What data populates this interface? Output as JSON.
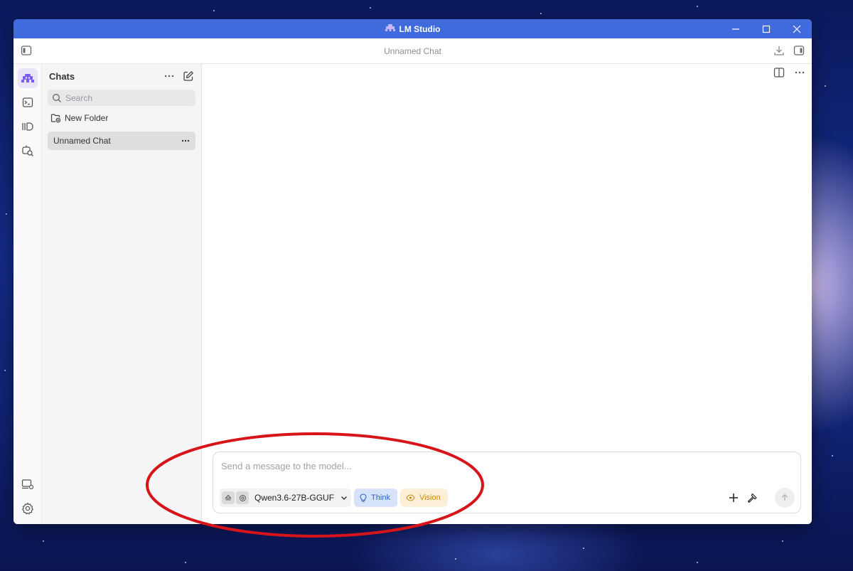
{
  "window": {
    "app_title": "LM Studio",
    "chat_title": "Unnamed Chat"
  },
  "sidebar": {
    "heading": "Chats",
    "search_placeholder": "Search",
    "new_folder_label": "New Folder",
    "chats": [
      {
        "label": "Unnamed Chat"
      }
    ]
  },
  "composer": {
    "placeholder": "Send a message to the model...",
    "model_name": "Qwen3.6-27B-GGUF",
    "think_label": "Think",
    "vision_label": "Vision"
  },
  "colors": {
    "titlebar": "#3f6bdc",
    "accent_purple": "#7b5cf0",
    "think_blue": "#2f5fc7",
    "vision_orange": "#c98a10",
    "annotation_red": "#d7141a"
  },
  "icons": {
    "app_logo": "lm-studio-logo-icon",
    "sidebar_toggle": "sidebar-toggle-icon",
    "download": "download-icon",
    "right_panel": "right-panel-icon",
    "split_view": "split-view-icon",
    "more": "more-icon",
    "new_chat": "new-chat-icon",
    "search": "search-icon",
    "folder_add": "folder-add-icon",
    "chat_nav": "chat-icon",
    "terminal": "terminal-icon",
    "models": "models-icon",
    "discover": "discover-icon",
    "hardware": "hardware-icon",
    "settings": "settings-icon",
    "eject": "eject-icon",
    "model_settings": "model-settings-icon",
    "chevron_down": "chevron-down-icon",
    "bulb": "lightbulb-icon",
    "eye": "eye-icon",
    "plus": "plus-icon",
    "tool": "hammer-icon",
    "send": "send-arrow-icon"
  }
}
